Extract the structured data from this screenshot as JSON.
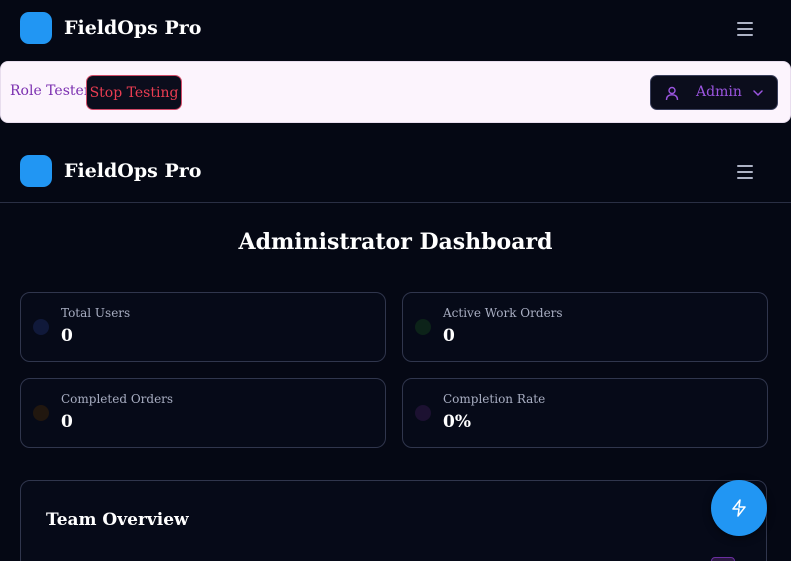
{
  "app": {
    "brand_name": "FieldOps Pro",
    "brand_color": "#2196f3"
  },
  "role_tester": {
    "label": "Role Tester",
    "stop_button": "Stop Testing",
    "selected_role": "Admin",
    "role_icon": "user-icon"
  },
  "dashboard": {
    "title": "Administrator Dashboard",
    "stats": [
      {
        "label": "Total Users",
        "value": "0",
        "dot_color": "#10193a"
      },
      {
        "label": "Active Work Orders",
        "value": "0",
        "dot_color": "#0c2319"
      },
      {
        "label": "Completed Orders",
        "value": "0",
        "dot_color": "#21170f"
      },
      {
        "label": "Completion Rate",
        "value": "0%",
        "dot_color": "#1c1131"
      }
    ],
    "team_overview_title": "Team Overview"
  },
  "fab_icon": "lightning-icon"
}
